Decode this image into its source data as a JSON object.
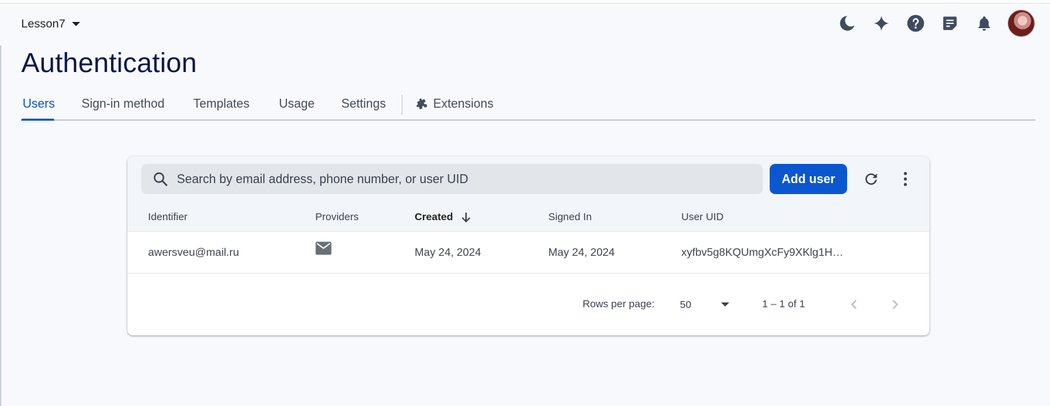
{
  "project": {
    "name": "Lesson7"
  },
  "header_icons": [
    "moon-icon",
    "sparkle-icon",
    "help-icon",
    "release-notes-icon",
    "bell-icon"
  ],
  "page": {
    "title": "Authentication"
  },
  "tabs": [
    {
      "label": "Users",
      "active": true
    },
    {
      "label": "Sign-in method"
    },
    {
      "label": "Templates"
    },
    {
      "label": "Usage"
    },
    {
      "label": "Settings"
    },
    {
      "label": "Extensions",
      "icon": "extension-puzzle-icon"
    }
  ],
  "search": {
    "placeholder": "Search by email address, phone number, or user UID"
  },
  "toolbar": {
    "add_user_label": "Add user"
  },
  "table": {
    "columns": [
      "Identifier",
      "Providers",
      "Created",
      "Signed In",
      "User UID"
    ],
    "sorted_column": "Created",
    "rows": [
      {
        "identifier": "awersveu@mail.ru",
        "provider": "email-icon",
        "created": "May 24, 2024",
        "signed_in": "May 24, 2024",
        "uid": "xyfbv5g8KQUmgXcFy9XKlg1H…"
      }
    ]
  },
  "pagination": {
    "rows_per_page_label": "Rows per page:",
    "rows_per_page_value": "50",
    "range_text": "1 – 1 of 1"
  },
  "colors": {
    "accent": "#0b57d0",
    "title": "#07174a"
  }
}
